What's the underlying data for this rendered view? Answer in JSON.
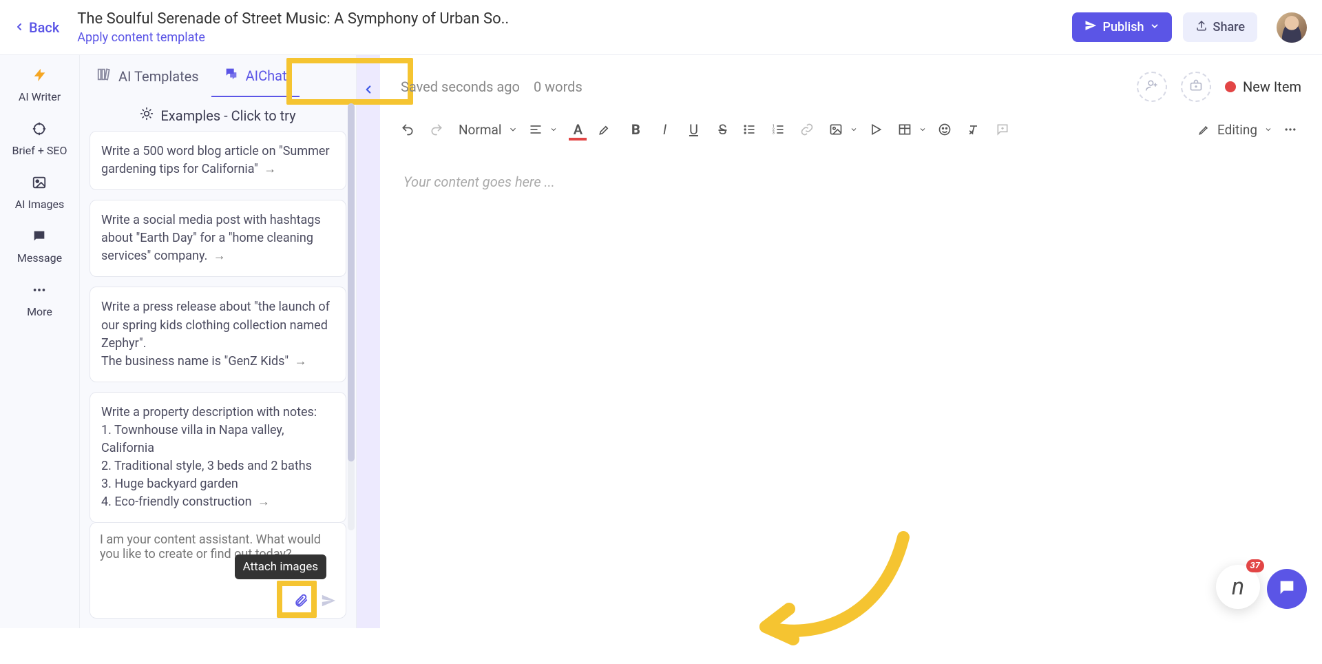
{
  "header": {
    "back_label": "Back",
    "title": "The Soulful Serenade of Street Music: A Symphony of Urban So..",
    "template_link": "Apply content template",
    "publish_label": "Publish",
    "share_label": "Share"
  },
  "left_sidebar": {
    "items": [
      {
        "label": "AI Writer"
      },
      {
        "label": "Brief + SEO"
      },
      {
        "label": "AI Images"
      },
      {
        "label": "Message"
      },
      {
        "label": "More"
      }
    ]
  },
  "ai_panel": {
    "tabs": [
      {
        "label": "AI Templates",
        "active": false
      },
      {
        "label": "AIChat",
        "active": true
      }
    ],
    "examples_header": "Examples - Click to try",
    "examples": [
      "Write a 500 word blog article on \"Summer gardening tips for California\"",
      "Write a social media post with hashtags about \"Earth Day\" for a \"home cleaning services\" company.",
      "Write a press release about \"the launch of our spring kids clothing collection named Zephyr\".\nThe business name is \"GenZ Kids\"",
      "Write a property description with notes:\n1. Townhouse villa in Napa valley, California\n2. Traditional style, 3 beds and 2 baths\n3. Huge backyard garden\n4. Eco-friendly construction"
    ],
    "chat_placeholder": "I am your content assistant. What would you like to create or find out today?",
    "attach_tooltip": "Attach images"
  },
  "editor": {
    "saved_text": "Saved seconds ago",
    "word_count": "0 words",
    "new_item_label": "New Item",
    "paragraph_style": "Normal",
    "mode_label": "Editing",
    "placeholder": "Your content goes here ..."
  },
  "widgets": {
    "chat_badge": "37"
  }
}
